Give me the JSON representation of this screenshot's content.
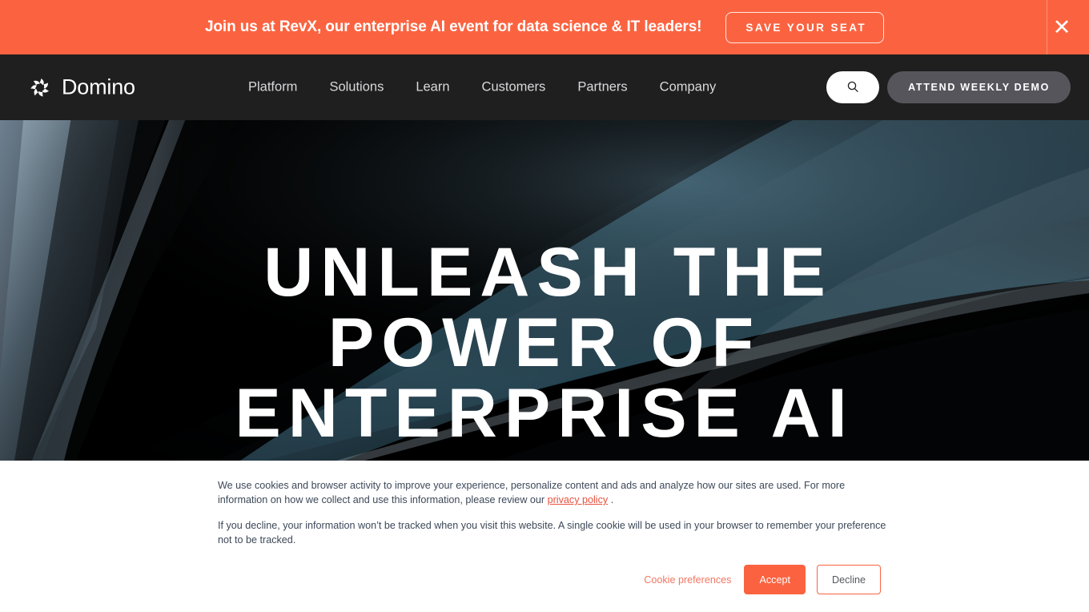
{
  "promo_banner": {
    "message": "Join us at RevX, our enterprise AI event for data science & IT leaders!",
    "cta_label": "SAVE YOUR SEAT",
    "close_icon": "close-icon",
    "close_glyph": "✕",
    "background_color": "#FB6340",
    "text_color": "#FFFFFF"
  },
  "nav": {
    "brand_name": "Domino",
    "brand_icon": "domino-pinwheel-logo-icon",
    "links": [
      {
        "label": "Platform"
      },
      {
        "label": "Solutions"
      },
      {
        "label": "Learn"
      },
      {
        "label": "Customers"
      },
      {
        "label": "Partners"
      },
      {
        "label": "Company"
      }
    ],
    "search_icon": "search-icon",
    "demo_label": "ATTEND WEEKLY DEMO",
    "background_color": "#1F1F1F",
    "link_color": "#D8D9DC",
    "demo_button_color": "#57555C"
  },
  "hero": {
    "headline": "UNLEASH THE\nPOWER OF\nENTERPRISE AI",
    "background_color": "#000000",
    "accent_color": "#2E4A55"
  },
  "cookie_banner": {
    "paragraph_1_before_link": "We use cookies and browser activity to improve your experience, personalize content and ads and analyze how our sites are used. For more information on how we collect and use this information, please review our ",
    "privacy_policy_label": "privacy policy",
    "paragraph_1_after_link": " .",
    "paragraph_2": "If you decline, your information won’t be tracked when you visit this website. A single cookie will be used in your browser to remember your preference not to be tracked.",
    "preferences_label": "Cookie preferences",
    "accept_label": "Accept",
    "decline_label": "Decline",
    "background_color": "#FFFFFF",
    "text_color": "#3C4858",
    "link_color": "#E8523F",
    "accept_color": "#FB6340"
  }
}
